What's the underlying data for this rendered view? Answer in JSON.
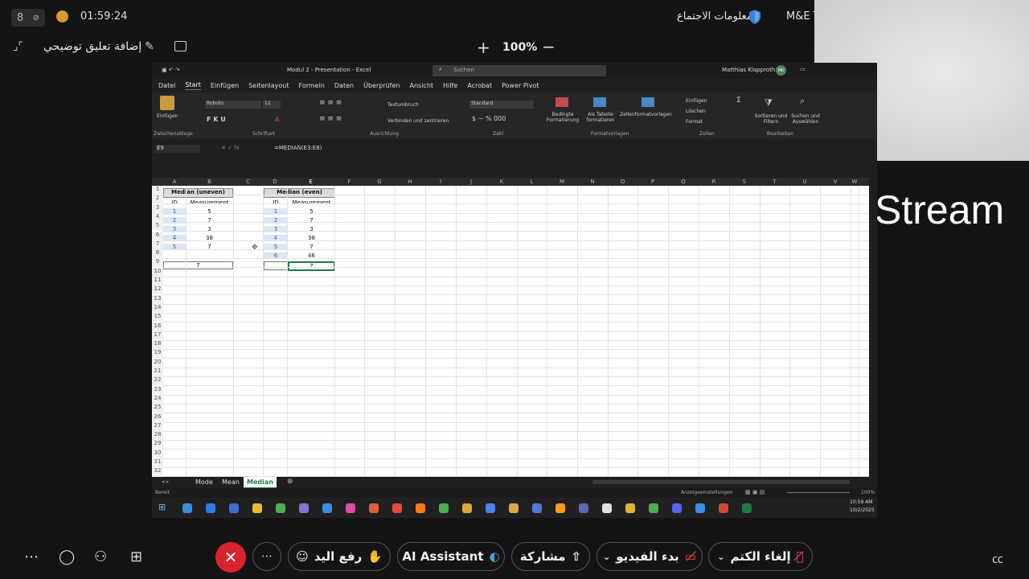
{
  "top": {
    "participants": "8",
    "elapsed": "01:59:24",
    "meeting_info": "معلومات الاجتماع",
    "org": "M&E Te"
  },
  "subbar": {
    "annotation": "إضافة تعليق توضيحي",
    "zoom": "100%"
  },
  "video": {
    "stream_label": "Stream"
  },
  "excel": {
    "title": "Modul 2 - Presentation - Excel",
    "search_placeholder": "Suchen",
    "user": "Matthias Klapproth",
    "user_initials": "MK",
    "menus": [
      "Datei",
      "Start",
      "Einfügen",
      "Seitenlayout",
      "Formeln",
      "Daten",
      "Überprüfen",
      "Ansicht",
      "Hilfe",
      "Acrobat",
      "Power Pivot"
    ],
    "ribbon": {
      "paste": "Einfügen",
      "font": "Roboto",
      "font_size": "11",
      "wrap": "Textumbruch",
      "merge": "Verbinden und zentrieren",
      "number_format": "Standard",
      "cond_format": "Bedingte Formatierung",
      "as_table": "Als Tabelle formatieren",
      "cell_styles": "Zellenformatvorlagen",
      "insert": "Einfügen",
      "delete": "Löschen",
      "format": "Format",
      "sort": "Sortieren und Filtern",
      "find": "Suchen und Auswählen",
      "groups": [
        "Zwischenablage",
        "Schriftart",
        "Ausrichtung",
        "Zahl",
        "Formatvorlagen",
        "Zellen",
        "Bearbeiten"
      ]
    },
    "name_box": "E9",
    "formula": "=MEDIAN(E3:E8)",
    "columns": [
      "A",
      "B",
      "C",
      "D",
      "E",
      "F",
      "G",
      "H",
      "I",
      "J",
      "K",
      "L",
      "M",
      "N",
      "O",
      "P",
      "Q",
      "R",
      "S",
      "T",
      "U",
      "V",
      "W"
    ],
    "table_uneven": {
      "title": "Median (uneven)",
      "headers": [
        "ID",
        "Measurement"
      ],
      "rows": [
        [
          "1",
          "5"
        ],
        [
          "2",
          "7"
        ],
        [
          "3",
          "3"
        ],
        [
          "4",
          "38"
        ],
        [
          "5",
          "7"
        ]
      ],
      "result": "7"
    },
    "table_even": {
      "title": "Median (even)",
      "headers": [
        "ID",
        "Measurement"
      ],
      "rows": [
        [
          "1",
          "5"
        ],
        [
          "2",
          "7"
        ],
        [
          "3",
          "3"
        ],
        [
          "4",
          "38"
        ],
        [
          "5",
          "7"
        ],
        [
          "6",
          "46"
        ]
      ],
      "result": "7"
    },
    "sheets": [
      "Mode",
      "Mean",
      "Median"
    ],
    "status_left": "Bereit",
    "status_display": "Anzeigeeinstellungen",
    "status_zoom": "100%",
    "clock_time": "10:59 AM",
    "clock_date": "10/2/2025"
  },
  "toolbar": {
    "mute": "إلغاء الكتم",
    "video": "بدء الفيديو",
    "share": "مشاركة",
    "ai": "AI Assistant",
    "raise_hand": "رفع اليد"
  }
}
